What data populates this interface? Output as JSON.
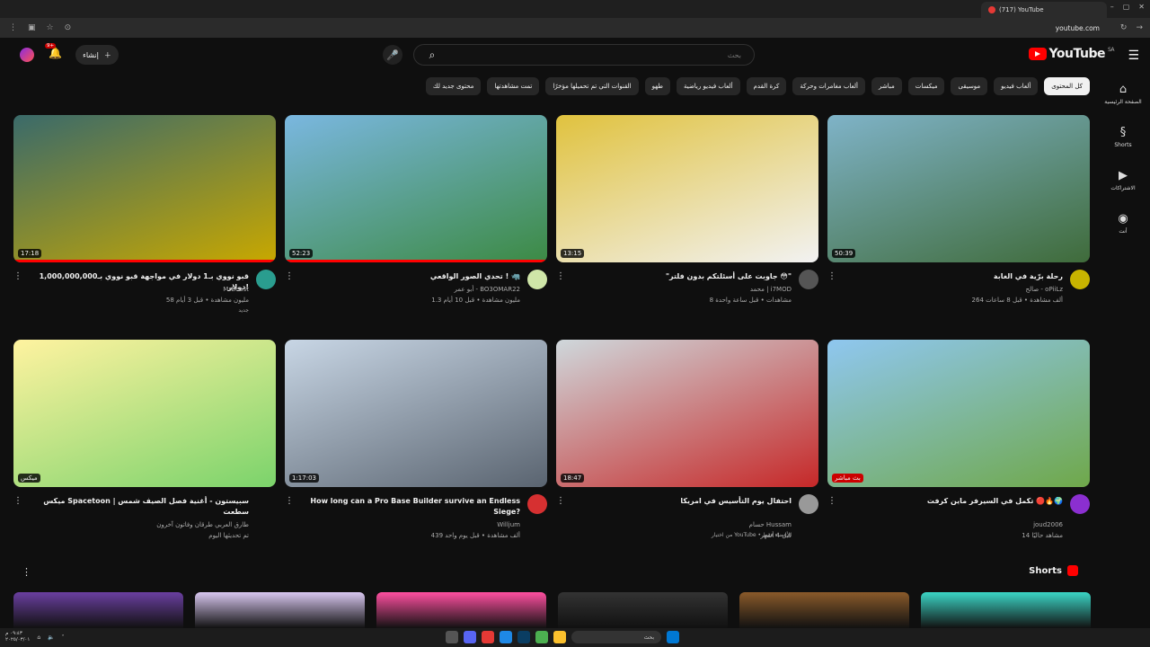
{
  "browser": {
    "tab_title": "(717) YouTube",
    "url": "youtube.com"
  },
  "header": {
    "logo_text": "YouTube",
    "logo_region": "SA",
    "search_placeholder": "بحث",
    "create_label": "إنشاء",
    "notification_count": "9+"
  },
  "chips": [
    "كل المحتوى",
    "ألعاب فيديو",
    "موسيقى",
    "ميكسات",
    "مباشر",
    "ألعاب مغامرات وحركة",
    "كرة القدم",
    "ألعاب فيديو رياضية",
    "طهو",
    "القنوات التي تم تحميلها مؤخرًا",
    "تمت مشاهدتها",
    "محتوى جديد لك"
  ],
  "sidebar": [
    {
      "label": "الصفحة الرئيسية",
      "icon": "home-icon"
    },
    {
      "label": "Shorts",
      "icon": "shorts-icon"
    },
    {
      "label": "الاشتراكات",
      "icon": "subscriptions-icon"
    },
    {
      "label": "أنت",
      "icon": "you-icon"
    }
  ],
  "videos_row1": [
    {
      "title": "رحلة برّية في الغابة",
      "channel": "صالح - oPiiLz",
      "stats": "264 ألف مشاهدة • قبل 8 ساعات",
      "extra": "",
      "duration": "50:39",
      "thumb_colors": [
        "#7fb3c8",
        "#3f6b3a"
      ],
      "avatar": "#c8b400"
    },
    {
      "title": "\"جاوبت على أسئلتكم بدون فلتر 😳\"",
      "channel": "محمد | i7MOD",
      "stats": "8 مشاهدات • قبل ساعة واحدة",
      "extra": "",
      "duration": "13:15",
      "thumb_colors": [
        "#e0c23e",
        "#f2f2f2"
      ],
      "avatar": "#555"
    },
    {
      "title": "تحدي الصور الواقعي ! 🦏",
      "channel": "أبو عمر - BO3OMAR22",
      "stats": "1.3 مليون مشاهدة • قبل 10 أيام",
      "extra": "",
      "duration": "52:23",
      "thumb_colors": [
        "#7ab7e0",
        "#3c8a44"
      ],
      "avatar": "#cfe6a8"
    },
    {
      "title": "قبو نووي بـ1 دولار في مواجهة قبو نووي بـ1,000,000,000 دولار!",
      "channel": "MrBeast",
      "stats": "58 مليون مشاهدة • قبل 3 أيام",
      "extra": "جديد",
      "duration": "17:18",
      "thumb_colors": [
        "#3a6a6a",
        "#c8a800"
      ],
      "avatar": "#2a9d8f"
    }
  ],
  "videos_row2": [
    {
      "title": "تكمل في السيرفر ماين كرفت 🔴🔥🌍",
      "channel": "joud2006",
      "stats": "14 مشاهد حاليًا",
      "extra": "",
      "duration": "بث مباشر",
      "thumb_colors": [
        "#8fc7f0",
        "#6fa84a"
      ],
      "avatar": "#8b2fd0",
      "live": true
    },
    {
      "title": "احتفال يوم التأسيس في امريكا",
      "channel": "حسام Hussam",
      "stats": "قبل 4 أشهر",
      "extra": "من اختيار YouTube • الأعضاء فقط",
      "duration": "18:47",
      "thumb_colors": [
        "#cfd8dc",
        "#c62828"
      ],
      "avatar": "#999"
    },
    {
      "title": "How long can a Pro Base Builder survive an Endless Siege?",
      "channel": "Willjum",
      "stats": "439 ألف مشاهدة • قبل يوم واحد",
      "extra": "",
      "duration": "1:17:03",
      "thumb_colors": [
        "#c8d6e5",
        "#5a6470"
      ],
      "avatar": "#d63031"
    },
    {
      "title": "ميكس Spacetoon | سبيستون - أغنية فصل الصيف شمس سطعت",
      "channel": "طارق العربي طرقان وفاتون آخرون",
      "stats": "تم تحديثها اليوم",
      "extra": "",
      "duration": "ميكس",
      "thumb_colors": [
        "#fff3a0",
        "#7bd36b"
      ],
      "avatar": ""
    }
  ],
  "shorts_title": "Shorts",
  "shorts_colors": [
    "#6a3fa0",
    "#d9c7f0",
    "#ff4fa0",
    "#333",
    "#8a5a2a",
    "#3bd6c6"
  ],
  "taskbar": {
    "search": "بحث",
    "time": "٠٩:٤٣ م",
    "date": "٢٠٢٥/٠٣/٠١"
  }
}
